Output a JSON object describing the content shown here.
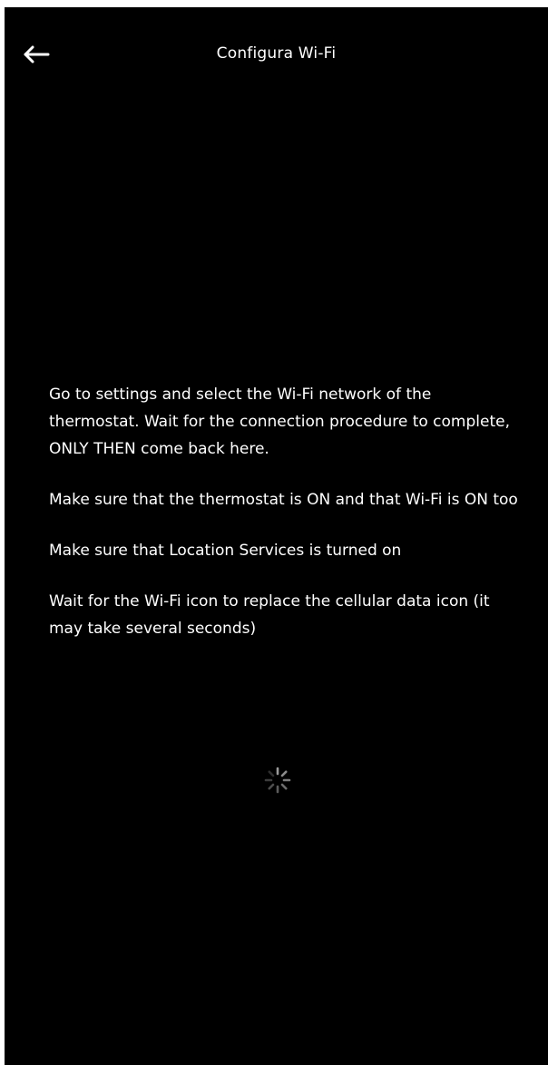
{
  "header": {
    "title": "Configura Wi-Fi",
    "back_icon": "arrow-left-icon"
  },
  "instructions": [
    "Go to settings and select the Wi-Fi network of the thermostat. Wait for the connection procedure to complete, ONLY THEN come back here.",
    "Make sure that the thermostat is ON and that Wi-Fi is ON too",
    "Make sure that Location Services is turned on",
    "Wait for the Wi-Fi icon to replace the cellular data icon (it may take several seconds)"
  ],
  "spinner_icon": "loading-spinner-icon",
  "colors": {
    "background": "#000000",
    "text": "#ffffff",
    "spinner": "#8a8a8a"
  }
}
